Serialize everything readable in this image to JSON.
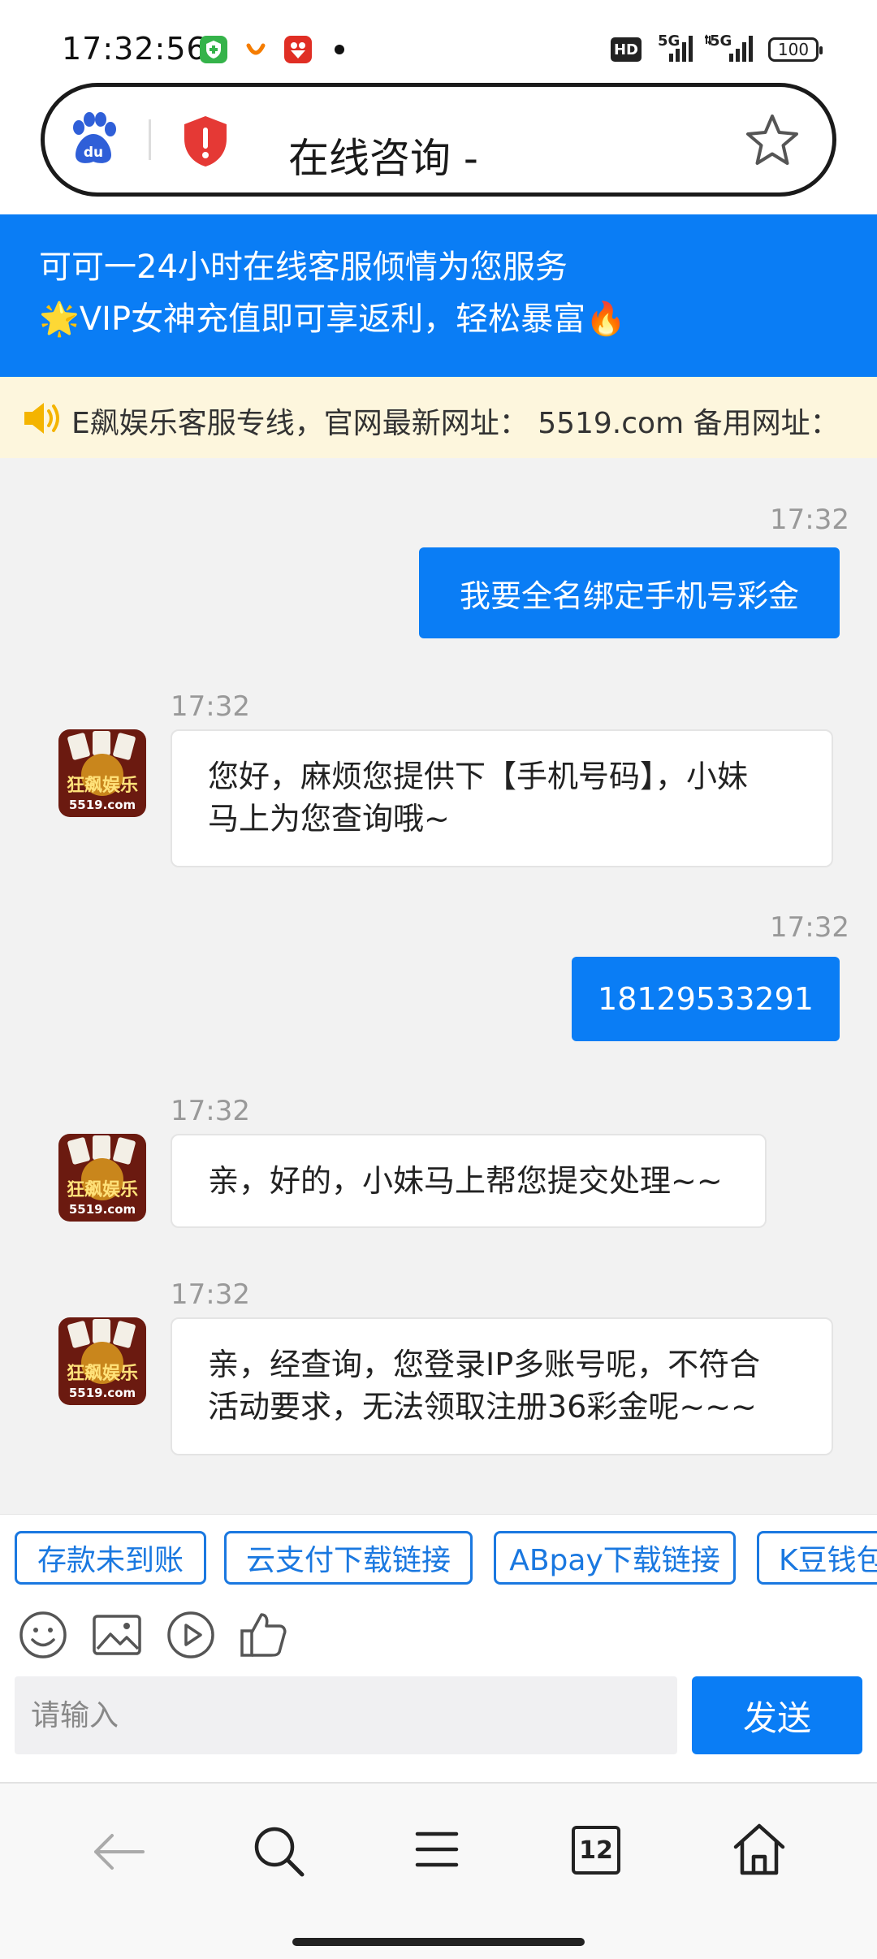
{
  "status_bar": {
    "time": "17:32:56",
    "network_1": "5G",
    "network_2": "5G",
    "battery": "100",
    "hd": "HD"
  },
  "address_bar": {
    "title": "在线咨询 -"
  },
  "header": {
    "line1": "可可一24小时在线客服倾情为您服务",
    "line2": "🌟VIP女神充值即可享返利，轻松暴富🔥"
  },
  "notice": {
    "text": "E飙娱乐客服专线，官网最新网址： 5519.com 备用网址："
  },
  "messages": [
    {
      "from": "me",
      "time": "17:32",
      "text": "我要全名绑定手机号彩金"
    },
    {
      "from": "agent",
      "time": "17:32",
      "lines": [
        "您好，麻烦您提供下【手机号码】，小妹",
        "马上为您查询哦~"
      ]
    },
    {
      "from": "me",
      "time": "17:32",
      "text": "18129533291"
    },
    {
      "from": "agent",
      "time": "17:32",
      "lines": [
        "亲，好的，小妹马上帮您提交处理~~"
      ]
    },
    {
      "from": "agent",
      "time": "17:32",
      "lines": [
        "亲，经查询，您登录IP多账号呢，不符合",
        "活动要求，无法领取注册36彩金呢~~~"
      ]
    }
  ],
  "avatar_text": {
    "brand": "狂飙娱乐",
    "site": "5519.com"
  },
  "quick_replies": [
    "存款未到账",
    "云支付下载链接",
    "ABpay下载链接",
    "K豆钱包"
  ],
  "composer": {
    "placeholder": "请输入",
    "send_label": "发送"
  },
  "nav": {
    "tab_count": "12"
  }
}
